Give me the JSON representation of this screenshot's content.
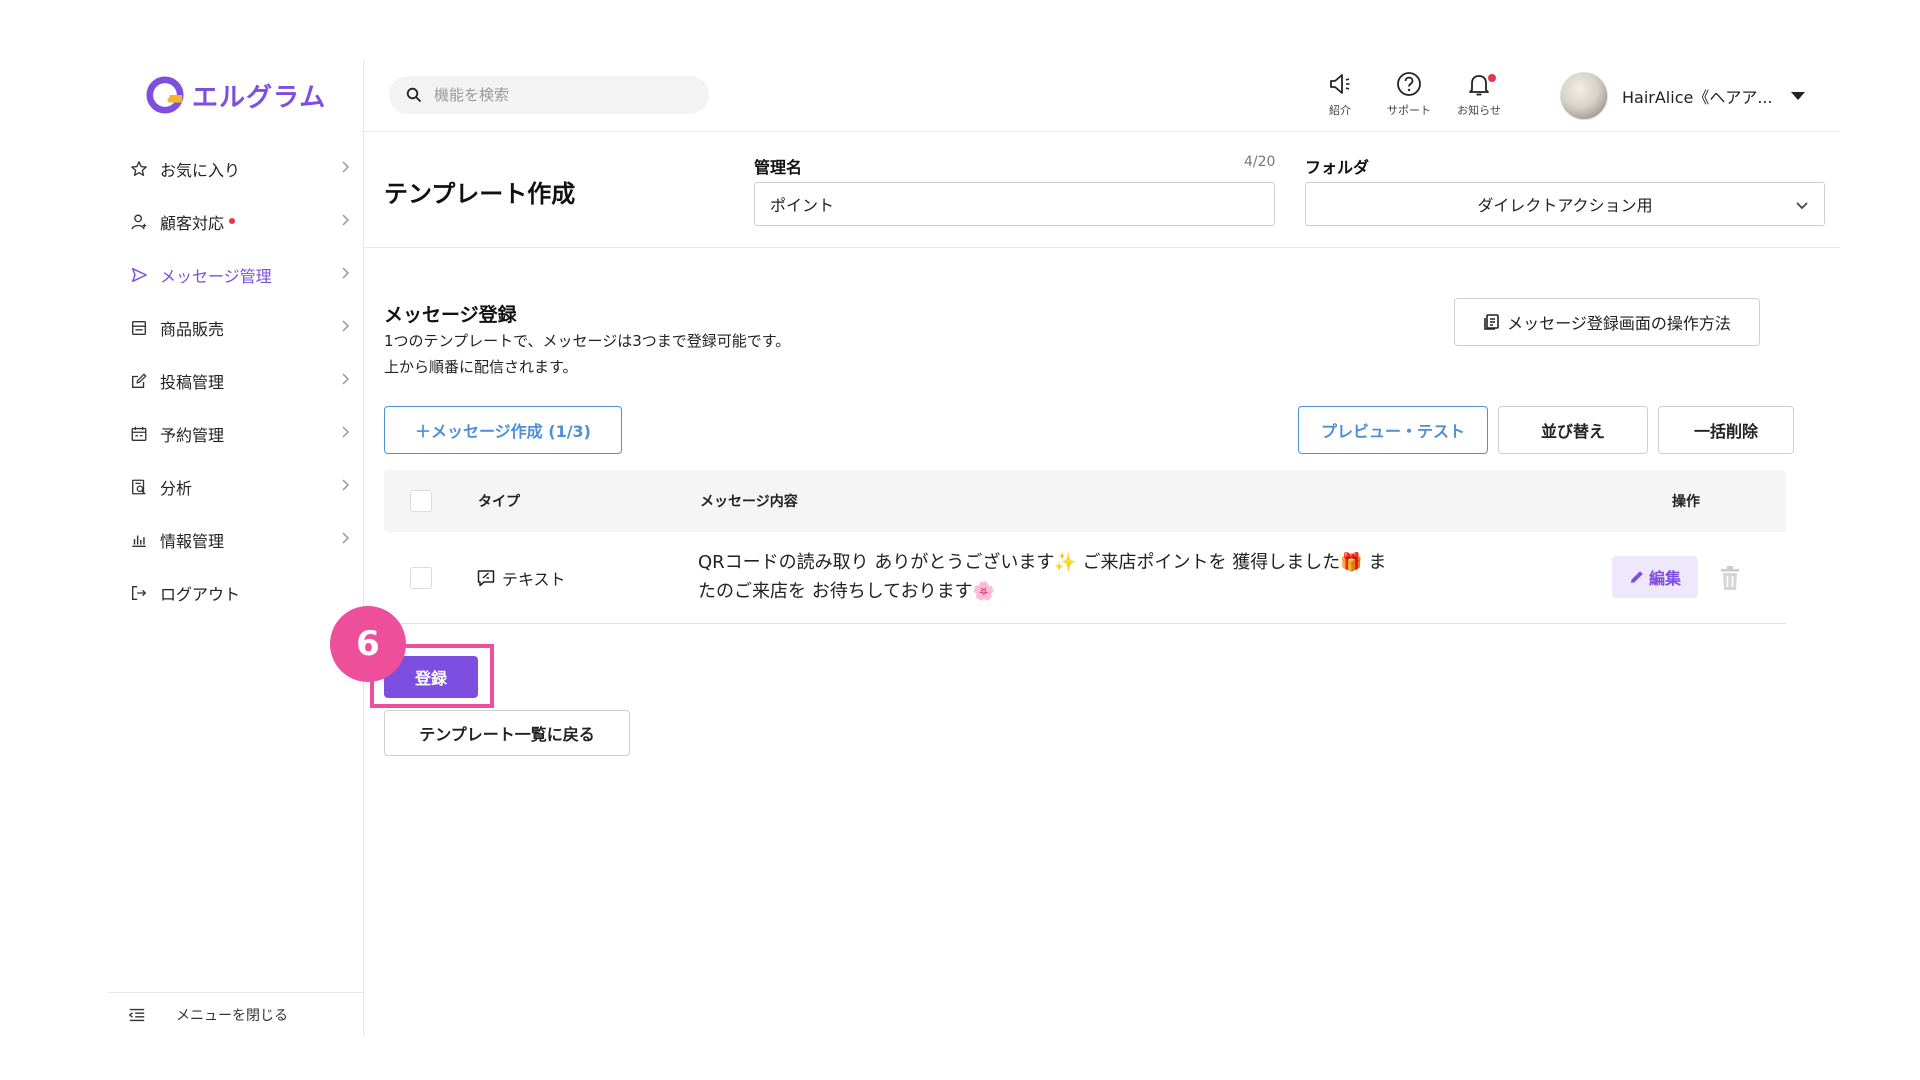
{
  "app": {
    "logo_text": "エルグラム",
    "brand_color": "#7d4ee0"
  },
  "sidebar": {
    "items": [
      {
        "label": "お気に入り",
        "icon": "star-icon"
      },
      {
        "label": "顧客対応",
        "icon": "user-icon",
        "has_alert": true
      },
      {
        "label": "メッセージ管理",
        "icon": "send-icon",
        "active": true
      },
      {
        "label": "商品販売",
        "icon": "store-icon"
      },
      {
        "label": "投稿管理",
        "icon": "edit-icon"
      },
      {
        "label": "予約管理",
        "icon": "calendar-icon"
      },
      {
        "label": "分析",
        "icon": "report-icon"
      },
      {
        "label": "情報管理",
        "icon": "bar-chart-icon"
      },
      {
        "label": "ログアウト",
        "icon": "logout-icon"
      }
    ],
    "collapse_label": "メニューを閉じる"
  },
  "header": {
    "search_placeholder": "機能を検索",
    "icons": [
      {
        "label": "紹介",
        "icon": "megaphone-icon"
      },
      {
        "label": "サポート",
        "icon": "help-icon"
      },
      {
        "label": "お知らせ",
        "icon": "bell-icon",
        "has_alert": true
      }
    ],
    "user_name": "HairAlice《ヘアア..."
  },
  "template": {
    "title": "テンプレート作成",
    "name_label": "管理名",
    "name_counter": "4/20",
    "name_value": "ポイント",
    "folder_label": "フォルダ",
    "folder_value": "ダイレクトアクション用"
  },
  "messages": {
    "title": "メッセージ登録",
    "desc_line1": "1つのテンプレートで、メッセージは3つまで登録可能です。",
    "desc_line2": "上から順番に配信されます。",
    "help_button": "メッセージ登録画面の操作方法",
    "create_button": "＋メッセージ作成 (1/3)",
    "preview_button": "プレビュー・テスト",
    "sort_button": "並び替え",
    "bulk_delete_button": "一括削除",
    "columns": {
      "type": "タイプ",
      "content": "メッセージ内容",
      "actions": "操作"
    },
    "rows": [
      {
        "type": "テキスト",
        "content": "QRコードの読み取り ありがとうございます✨ ご来店ポイントを 獲得しました🎁 またのご来店を お待ちしております🌸",
        "edit_label": "編集"
      }
    ]
  },
  "footer": {
    "step_number": "6",
    "submit_button": "登録",
    "back_button": "テンプレート一覧に戻る",
    "highlight_color": "#ee4f9b"
  }
}
